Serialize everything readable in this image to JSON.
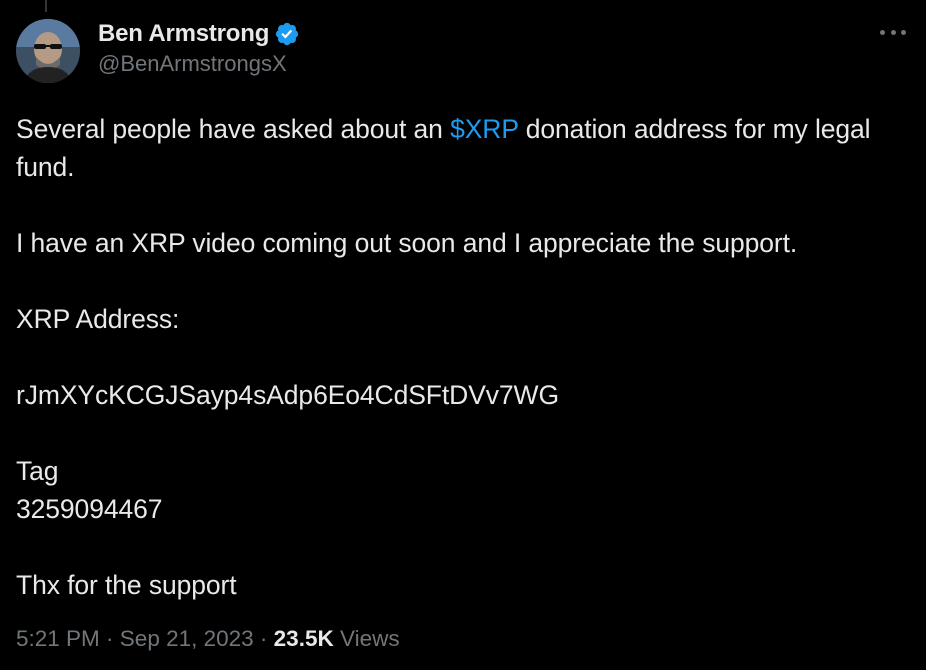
{
  "author": {
    "display_name": "Ben Armstrong",
    "handle": "@BenArmstrongsX",
    "verified": true
  },
  "icons": {
    "verified": "verified-badge-icon",
    "more": "more-horizontal-icon"
  },
  "tweet": {
    "line1_before": "Several people have asked about an ",
    "cashtag": "$XRP",
    "line1_after": " donation address for my legal fund.",
    "line2": "I have an XRP video coming out soon and I appreciate the support.",
    "line3": "XRP Address:",
    "address": "rJmXYcKCGJSayp4sAdp6Eo4CdSFtDVv7WG",
    "tag_label": "Tag",
    "tag_value": "3259094467",
    "closing": "Thx for the support"
  },
  "meta": {
    "time": "5:21 PM",
    "separator": " · ",
    "date": "Sep 21, 2023",
    "views_count": "23.5K",
    "views_label": " Views"
  },
  "colors": {
    "background": "#000000",
    "text": "#e7e9ea",
    "secondary": "#71767b",
    "accent": "#1d9bf0"
  }
}
